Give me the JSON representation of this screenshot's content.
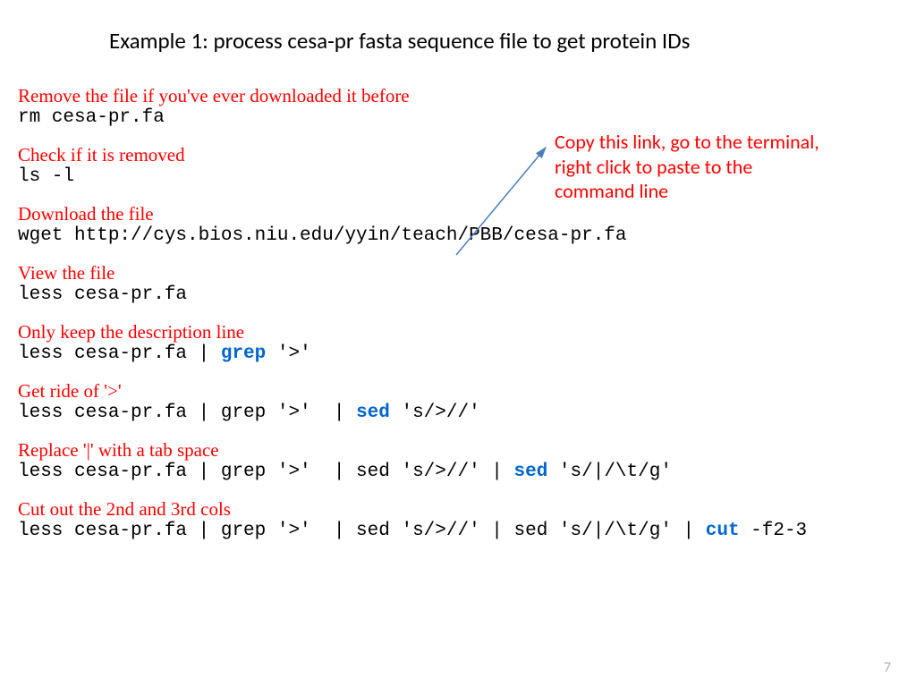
{
  "title": "Example 1: process cesa-pr fasta sequence file to get protein IDs",
  "callout": "Copy this link, go to the terminal, right click to paste to the command line",
  "page_number": "7",
  "steps": {
    "s1": {
      "desc": "Remove the file if you've ever downloaded it before",
      "cmd": "rm cesa-pr.fa"
    },
    "s2": {
      "desc": "Check if it is removed",
      "cmd": "ls -l"
    },
    "s3": {
      "desc": "Download the file",
      "cmd": "wget http://cys.bios.niu.edu/yyin/teach/PBB/cesa-pr.fa"
    },
    "s4": {
      "desc": "View the file",
      "cmd": "less cesa-pr.fa"
    },
    "s5": {
      "desc": "Only keep the description line",
      "cmd_pre": "less cesa-pr.fa | ",
      "kw": "grep",
      "cmd_post": " '>'"
    },
    "s6": {
      "desc": "Get ride of '>'",
      "cmd_pre": "less cesa-pr.fa | grep '>'  | ",
      "kw": "sed",
      "cmd_post": " 's/>//'"
    },
    "s7": {
      "desc": "Replace '|' with a tab space",
      "cmd_pre": "less cesa-pr.fa | grep '>'  | sed 's/>//' | ",
      "kw": "sed",
      "cmd_post": " 's/|/\\t/g'"
    },
    "s8": {
      "desc": "Cut out the 2nd and 3rd cols",
      "cmd_pre": "less cesa-pr.fa | grep '>'  | sed 's/>//' | sed 's/|/\\t/g' | ",
      "kw": "cut",
      "cmd_post": " -f2-3"
    }
  }
}
